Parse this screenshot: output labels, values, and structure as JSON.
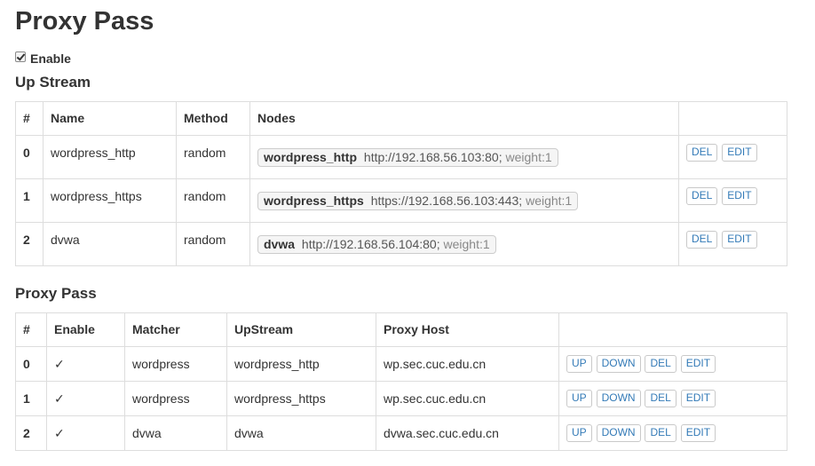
{
  "page_title": "Proxy Pass",
  "enable_label": "Enable",
  "upstream": {
    "title": "Up Stream",
    "headers": [
      "#",
      "Name",
      "Method",
      "Nodes",
      ""
    ],
    "rows": [
      {
        "idx": "0",
        "name": "wordpress_http",
        "method": "random",
        "node_name": "wordpress_http",
        "node_addr": "http://192.168.56.103:80;",
        "node_weight": "weight:1"
      },
      {
        "idx": "1",
        "name": "wordpress_https",
        "method": "random",
        "node_name": "wordpress_https",
        "node_addr": "https://192.168.56.103:443;",
        "node_weight": "weight:1"
      },
      {
        "idx": "2",
        "name": "dvwa",
        "method": "random",
        "node_name": "dvwa",
        "node_addr": "http://192.168.56.104:80;",
        "node_weight": "weight:1"
      }
    ],
    "del_label": "DEL",
    "edit_label": "EDIT"
  },
  "proxypass": {
    "title": "Proxy Pass",
    "headers": [
      "#",
      "Enable",
      "Matcher",
      "UpStream",
      "Proxy Host",
      ""
    ],
    "rows": [
      {
        "idx": "0",
        "enable": "✓",
        "matcher": "wordpress",
        "upstream": "wordpress_http",
        "host": "wp.sec.cuc.edu.cn"
      },
      {
        "idx": "1",
        "enable": "✓",
        "matcher": "wordpress",
        "upstream": "wordpress_https",
        "host": "wp.sec.cuc.edu.cn"
      },
      {
        "idx": "2",
        "enable": "✓",
        "matcher": "dvwa",
        "upstream": "dvwa",
        "host": "dvwa.sec.cuc.edu.cn"
      }
    ],
    "up_label": "UP",
    "down_label": "DOWN",
    "del_label": "DEL",
    "edit_label": "EDIT"
  },
  "colors": {
    "link": "#337ab7",
    "border": "#dddddd",
    "text": "#333333"
  }
}
